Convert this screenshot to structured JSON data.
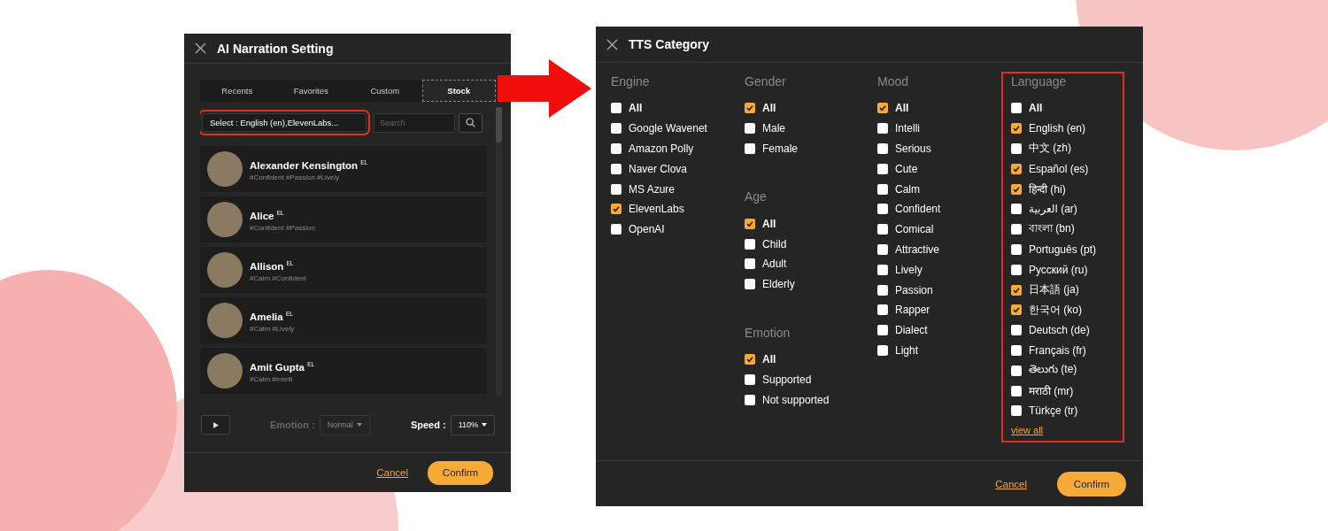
{
  "narration": {
    "title": "AI Narration Setting",
    "tabs": [
      {
        "label": "Recents",
        "selected": false
      },
      {
        "label": "Favorites",
        "selected": false
      },
      {
        "label": "Custom",
        "selected": false
      },
      {
        "label": "Stock",
        "selected": true
      }
    ],
    "filter": {
      "value": "Select : English (en),ElevenLabs...",
      "highlighted": true
    },
    "search": {
      "placeholder": "Search"
    },
    "voices": [
      {
        "name": "Alexander Kensington $^{EL}$",
        "tags": "#Confident #Passion #Lively"
      },
      {
        "name": "Alice $^{EL}$",
        "tags": "#Confident #Passion"
      },
      {
        "name": "Allison $^{EL}$",
        "tags": "#Calm #Confident"
      },
      {
        "name": "Amelia $^{EL}$",
        "tags": "#Calm #Lively"
      },
      {
        "name": "Amit Gupta $^{EL}$",
        "tags": "#Calm #Intelli"
      }
    ],
    "emotion": {
      "label": "Emotion :",
      "value": "Normal",
      "disabled": true
    },
    "speed": {
      "label": "Speed :",
      "value": "110%",
      "disabled": false
    },
    "cancel": "Cancel",
    "confirm": "Confirm"
  },
  "tts_category": {
    "title": "TTS Category",
    "columns": [
      {
        "groups": [
          {
            "heading": "Engine",
            "highlighted": false,
            "options": [
              {
                "label": "All",
                "checked": false
              },
              {
                "label": "Google Wavenet",
                "checked": false
              },
              {
                "label": "Amazon Polly",
                "checked": false
              },
              {
                "label": "Naver Clova",
                "checked": false
              },
              {
                "label": "MS Azure",
                "checked": false
              },
              {
                "label": "ElevenLabs",
                "checked": true
              },
              {
                "label": "OpenAI",
                "checked": false
              }
            ]
          }
        ]
      },
      {
        "groups": [
          {
            "heading": "Gender",
            "highlighted": false,
            "options": [
              {
                "label": "All",
                "checked": true
              },
              {
                "label": "Male",
                "checked": false
              },
              {
                "label": "Female",
                "checked": false
              }
            ]
          },
          {
            "heading": "Age",
            "highlighted": false,
            "options": [
              {
                "label": "All",
                "checked": true
              },
              {
                "label": "Child",
                "checked": false
              },
              {
                "label": "Adult",
                "checked": false
              },
              {
                "label": "Elderly",
                "checked": false
              }
            ]
          },
          {
            "heading": "Emotion",
            "highlighted": false,
            "options": [
              {
                "label": "All",
                "checked": true
              },
              {
                "label": "Supported",
                "checked": false
              },
              {
                "label": "Not supported",
                "checked": false
              }
            ]
          }
        ]
      },
      {
        "groups": [
          {
            "heading": "Mood",
            "highlighted": false,
            "options": [
              {
                "label": "All",
                "checked": true
              },
              {
                "label": "Intelli",
                "checked": false
              },
              {
                "label": "Serious",
                "checked": false
              },
              {
                "label": "Cute",
                "checked": false
              },
              {
                "label": "Calm",
                "checked": false
              },
              {
                "label": "Confident",
                "checked": false
              },
              {
                "label": "Comical",
                "checked": false
              },
              {
                "label": "Attractive",
                "checked": false
              },
              {
                "label": "Lively",
                "checked": false
              },
              {
                "label": "Passion",
                "checked": false
              },
              {
                "label": "Rapper",
                "checked": false
              },
              {
                "label": "Dialect",
                "checked": false
              },
              {
                "label": "Light",
                "checked": false
              }
            ]
          }
        ]
      },
      {
        "groups": [
          {
            "heading": "Language",
            "highlighted": true,
            "view_all": "view all",
            "options": [
              {
                "label": "All",
                "checked": false
              },
              {
                "label": "English (en)",
                "checked": true
              },
              {
                "label": "中文 (zh)",
                "checked": false
              },
              {
                "label": "Español (es)",
                "checked": true
              },
              {
                "label": "हिन्दी (hi)",
                "checked": true
              },
              {
                "label": "العربية (ar)",
                "checked": false
              },
              {
                "label": "বাংলা (bn)",
                "checked": false
              },
              {
                "label": "Português (pt)",
                "checked": false
              },
              {
                "label": "Русский (ru)",
                "checked": false
              },
              {
                "label": "日本語 (ja)",
                "checked": true
              },
              {
                "label": "한국어 (ko)",
                "checked": true
              },
              {
                "label": "Deutsch (de)",
                "checked": false
              },
              {
                "label": "Français (fr)",
                "checked": false
              },
              {
                "label": "తెలుగు (te)",
                "checked": false
              },
              {
                "label": "मराठी (mr)",
                "checked": false
              },
              {
                "label": "Türkçe (tr)",
                "checked": false
              }
            ]
          }
        ]
      }
    ],
    "cancel": "Cancel",
    "confirm": "Confirm"
  }
}
